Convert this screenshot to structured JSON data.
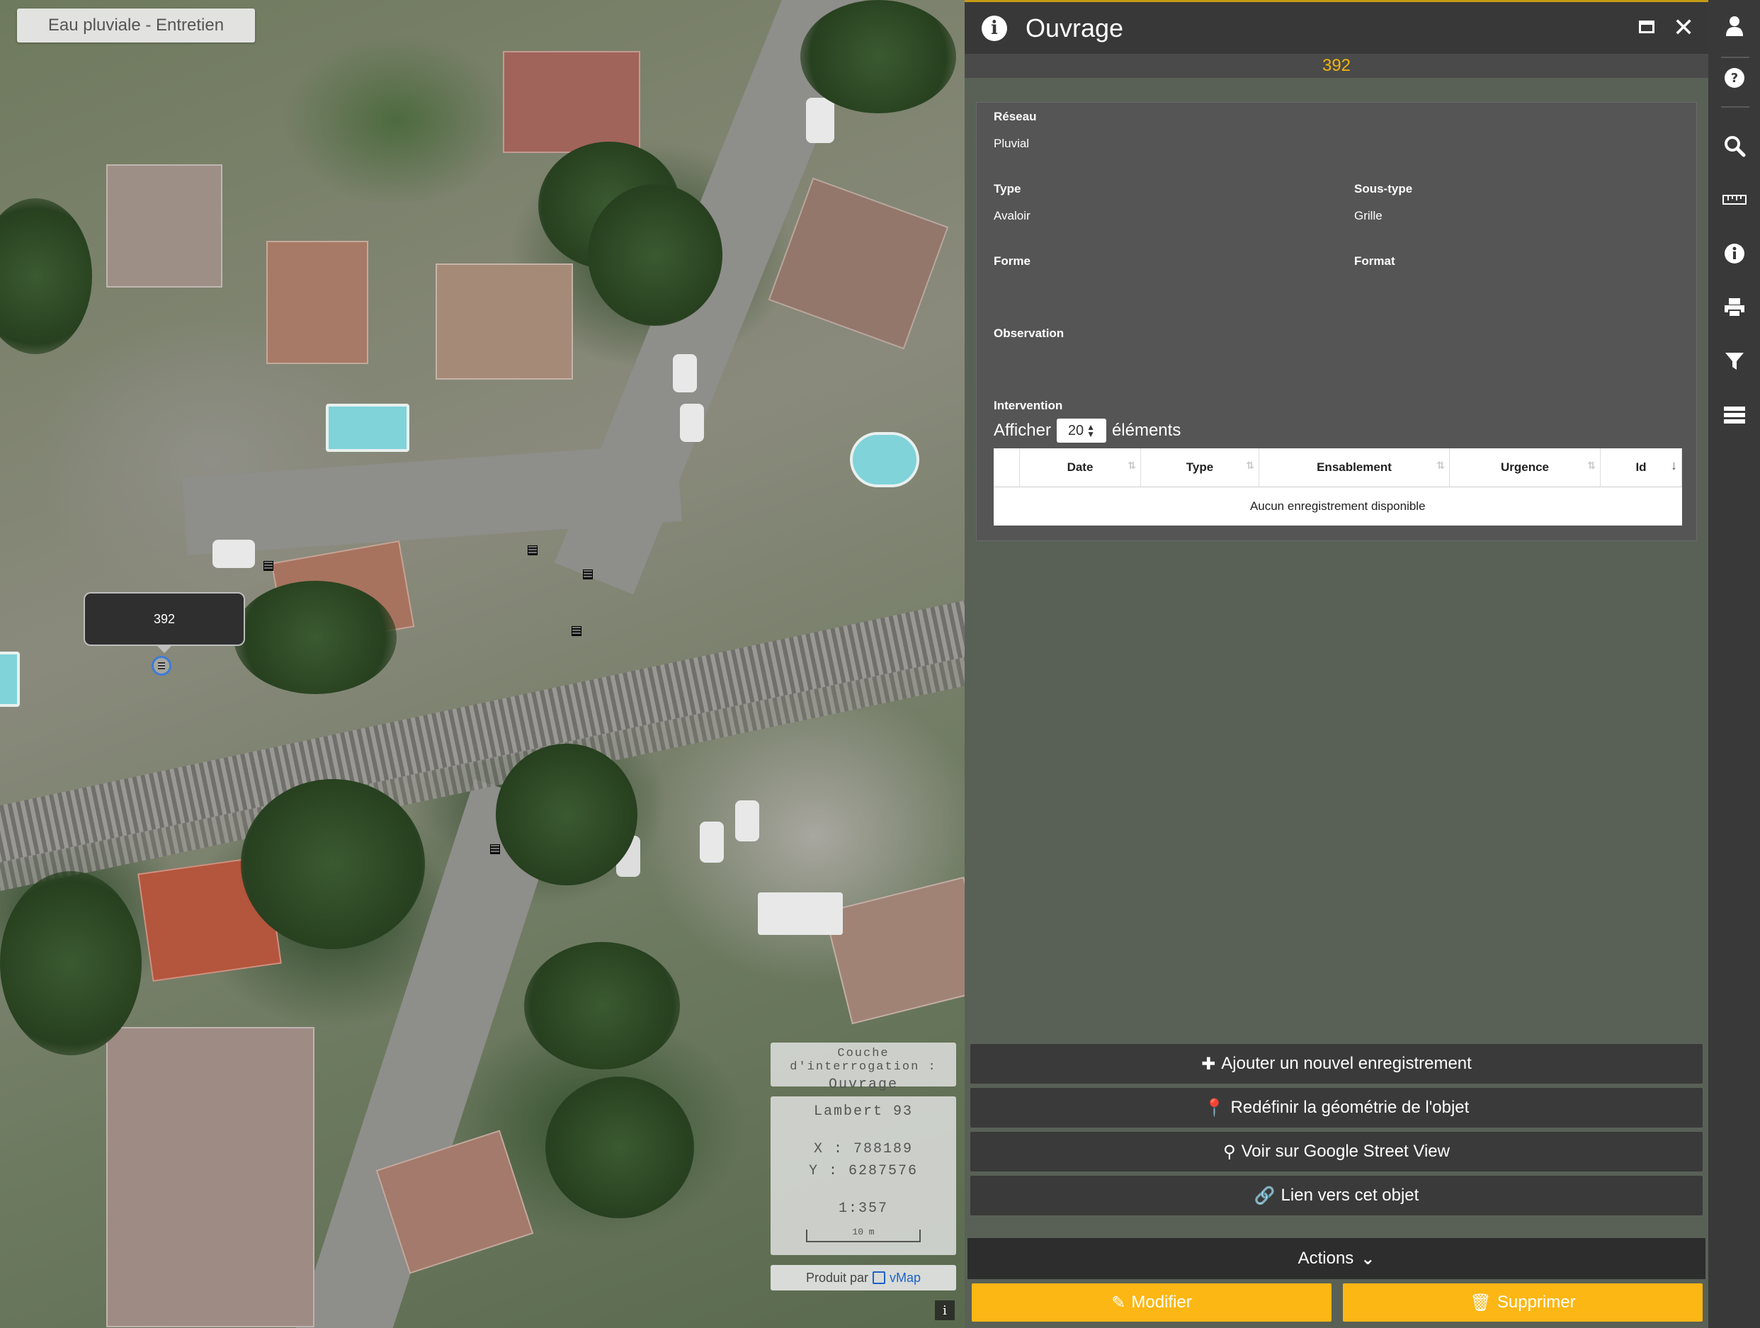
{
  "map": {
    "layer_chip": "Eau pluviale - Entretien",
    "feature_label": "392",
    "query_layer_label": "Couche d'interrogation :",
    "query_layer_value": "Ouvrage",
    "projection": "Lambert 93",
    "x": "X : 788189",
    "y": "Y : 6287576",
    "scale": "1:357",
    "scale_bar": "10 m",
    "credit_prefix": "Produit par",
    "credit_brand": "vMap",
    "info_button": "i"
  },
  "panel": {
    "title": "Ouvrage",
    "subtitle": "392",
    "fields": {
      "reseau_label": "Réseau",
      "reseau_value": "Pluvial",
      "type_label": "Type",
      "type_value": "Avaloir",
      "soustype_label": "Sous-type",
      "soustype_value": "Grille",
      "forme_label": "Forme",
      "format_label": "Format",
      "observation_label": "Observation",
      "intervention_label": "Intervention"
    },
    "table": {
      "show_prefix": "Afficher",
      "page_size": "20",
      "show_suffix": "éléments",
      "columns": [
        "Date",
        "Type",
        "Ensablement",
        "Urgence",
        "Id"
      ],
      "empty_message": "Aucun enregistrement disponible"
    },
    "buttons": {
      "add": "Ajouter un nouvel enregistrement",
      "redefine": "Redéfinir la géométrie de l'objet",
      "street_view": "Voir sur Google Street View",
      "link": "Lien vers cet objet",
      "actions": "Actions",
      "edit": "Modifier",
      "delete": "Supprimer"
    }
  },
  "colors": {
    "accent": "#fcb714",
    "header": "#383838",
    "subtitle_text": "#f3b50c",
    "sidebar": "#393939"
  },
  "sidebar_icons": [
    "user-icon",
    "help-icon",
    "search-icon",
    "ruler-icon",
    "info-icon",
    "print-icon",
    "filter-icon",
    "layers-icon"
  ]
}
